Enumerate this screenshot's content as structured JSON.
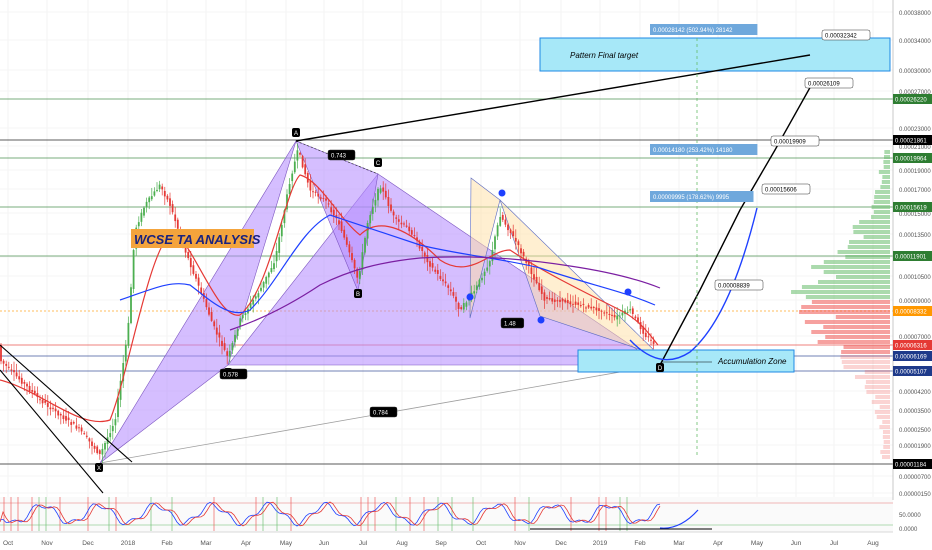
{
  "chart_data": {
    "type": "candlestick",
    "y_scale": "log",
    "title": "WCSE TA ANALYSIS",
    "x_ticks": [
      "Oct",
      "Nov",
      "Dec",
      "2018",
      "Feb",
      "Mar",
      "Apr",
      "May",
      "Jun",
      "Jul",
      "Aug",
      "Sep",
      "Oct",
      "Nov",
      "Dec",
      "2019",
      "Feb",
      "Mar",
      "Apr",
      "May",
      "Jun",
      "Jul",
      "Aug"
    ],
    "y_ticks": [
      "0.00038000",
      "0.00034000",
      "0.00030000",
      "0.00027000",
      "0.00023000",
      "0.00021000",
      "0.00019000",
      "0.00017000",
      "0.00015000",
      "0.00013500",
      "0.00012000",
      "0.00010500",
      "0.00009000",
      "0.00007000",
      "0.00004200",
      "0.00003500",
      "0.00002500",
      "0.00001900",
      "0.00001500",
      "0.00000700",
      "0.00000150"
    ],
    "y_ticks_actual": [
      0.00038,
      0.00034,
      0.0003,
      0.00027,
      0.00023,
      0.00021,
      0.00019,
      0.00017,
      0.00015,
      0.000135,
      0.00012,
      0.000105,
      9e-05,
      7e-05,
      4.2e-05,
      3.5e-05,
      2.5e-05,
      1.9e-05,
      1.5e-05,
      7e-06,
      1.5e-06
    ],
    "price_labels": [
      {
        "value": "0.00026220",
        "price": 0.0002622,
        "color": "#2e7d32"
      },
      {
        "value": "0.00021861",
        "price": 0.00021861,
        "color": "#000000"
      },
      {
        "value": "0.00019964",
        "price": 0.00019964,
        "color": "#2e7d32"
      },
      {
        "value": "0.00015619",
        "price": 0.00015619,
        "color": "#2e7d32"
      },
      {
        "value": "0.00011901",
        "price": 0.00011901,
        "color": "#2e7d32"
      },
      {
        "value": "0.00008332",
        "price": 8.332e-05,
        "color": "#ff9800"
      },
      {
        "value": "0.00006316",
        "price": 6.316e-05,
        "color": "#e53935"
      },
      {
        "value": "0.00006169",
        "price": 6.169e-05,
        "color": "#1e3a8a"
      },
      {
        "value": "0.00005107",
        "price": 5.107e-05,
        "color": "#1e3a8a"
      },
      {
        "value": "0.00001184",
        "price": 1.184e-05,
        "color": "#000000"
      }
    ],
    "pattern_points": [
      {
        "label": "X",
        "date": "2017-12-10",
        "price": 1.18e-05
      },
      {
        "label": "A",
        "date": "2018-05-02",
        "price": 0.00021861
      },
      {
        "label": "B",
        "date": "2018-03-26",
        "price": 5.4e-05
      },
      {
        "label": "C",
        "date": "2018-07-20",
        "price": 0.000185
      },
      {
        "label": "B",
        "date": "2018-07-12",
        "price": 9e-05
      },
      {
        "label": "D",
        "date": "2019-02-15",
        "price": 5.107e-05
      }
    ],
    "ratio_labels": [
      "0.743",
      "0.578",
      "0.784",
      "1.48"
    ],
    "measure_labels": [
      "0.00028142 (502.94%) 28142",
      "0.00014180 (253.42%) 14180",
      "0.00009995 (178.62%) 9995"
    ],
    "target_labels": [
      "0.00032342",
      "0.00026109",
      "0.00019909",
      "0.00015606",
      "0.00008839"
    ],
    "zone_labels": [
      "Pattern Final target",
      "Accumulation Zone"
    ],
    "oscillator_ticks": [
      "50.0000",
      "0.0000"
    ],
    "colors": {
      "up": "#4caf50",
      "down": "#e53935",
      "ma_red": "#e53935",
      "ma_blue": "#1e40ff",
      "ma_purple": "#7b1fa2",
      "pattern": "#b388ff",
      "zone": "#a7e8f8",
      "title_bg": "#f4a43c"
    }
  }
}
